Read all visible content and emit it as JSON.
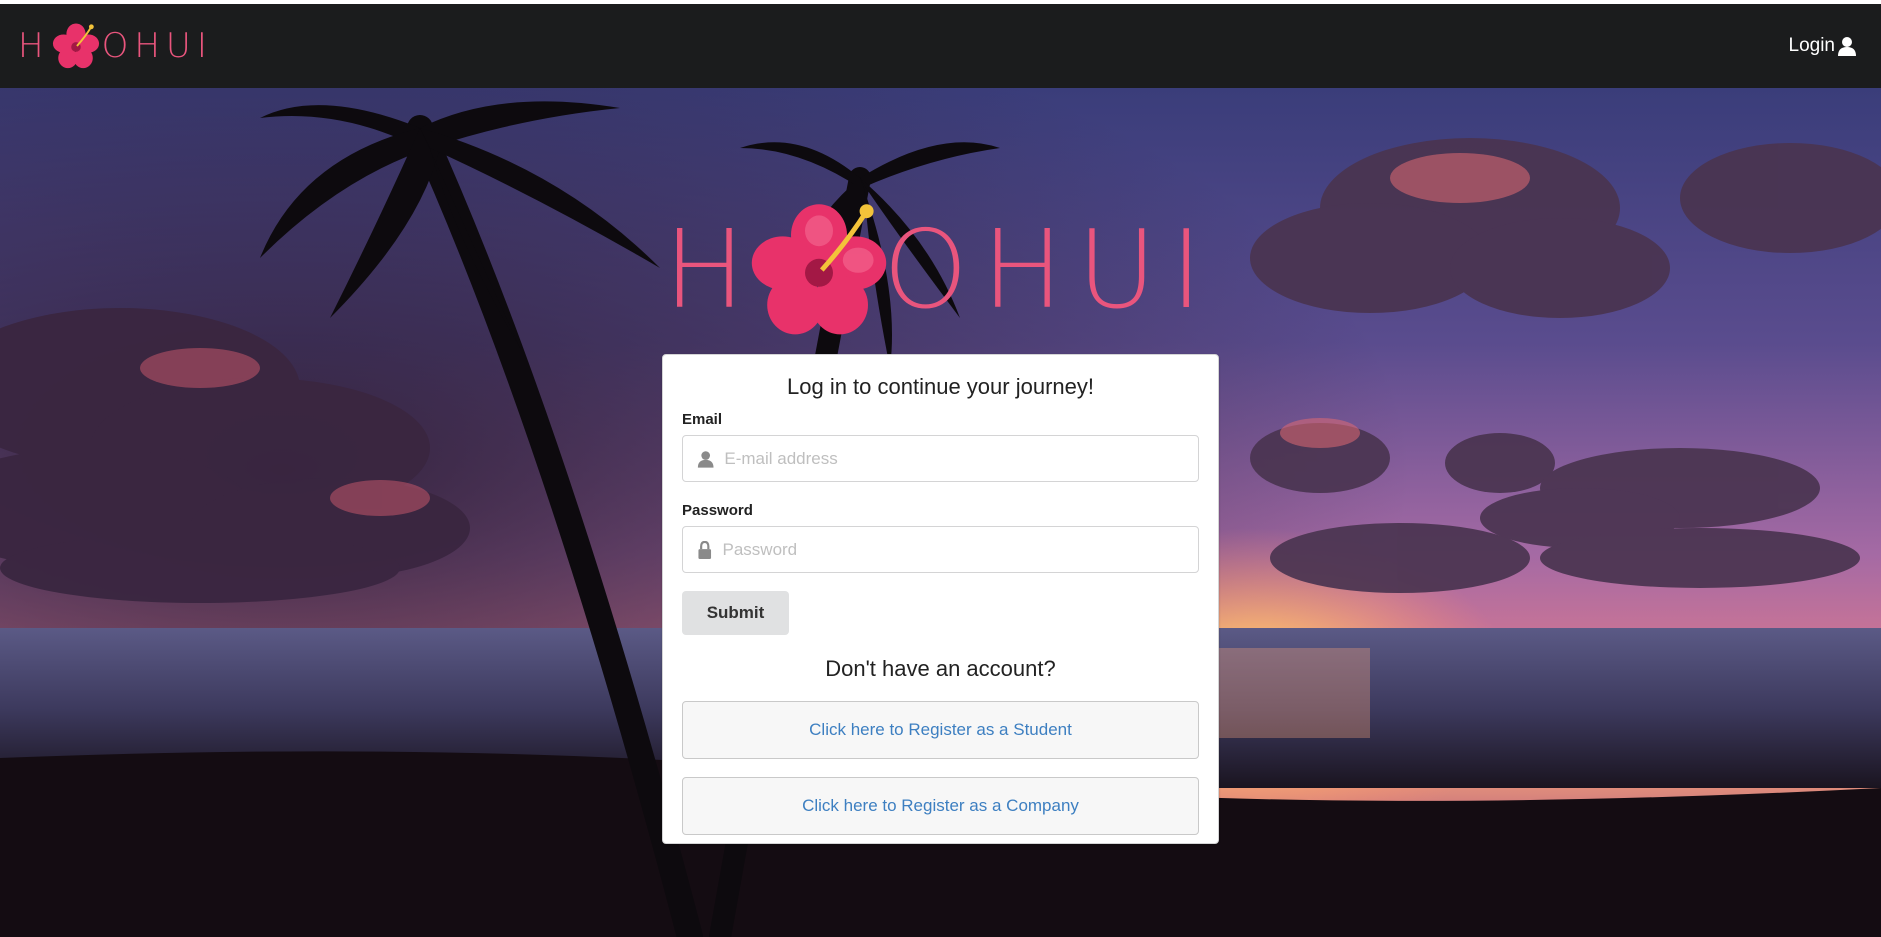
{
  "navbar": {
    "brand": [
      "H",
      "O",
      "H",
      "U",
      "I"
    ],
    "login_label": "Login",
    "login_icon": "user-icon"
  },
  "hero": {
    "brand": [
      "H",
      "O",
      "H",
      "U",
      "I"
    ],
    "flower_icon": "hibiscus-icon"
  },
  "login_card": {
    "title": "Log in to continue your journey!",
    "email": {
      "label": "Email",
      "placeholder": "E-mail address",
      "value": "",
      "icon": "user-icon"
    },
    "password": {
      "label": "Password",
      "placeholder": "Password",
      "value": "",
      "icon": "lock-icon"
    },
    "submit_label": "Submit",
    "no_account_text": "Don't have an account?",
    "register_student_label": "Click here to Register as a Student",
    "register_company_label": "Click here to Register as a Company"
  },
  "colors": {
    "brand_pink": "#e9557d",
    "navbar_bg": "#1b1c1d",
    "link_blue": "#3d7fc1",
    "submit_bg": "#e0e1e2"
  }
}
